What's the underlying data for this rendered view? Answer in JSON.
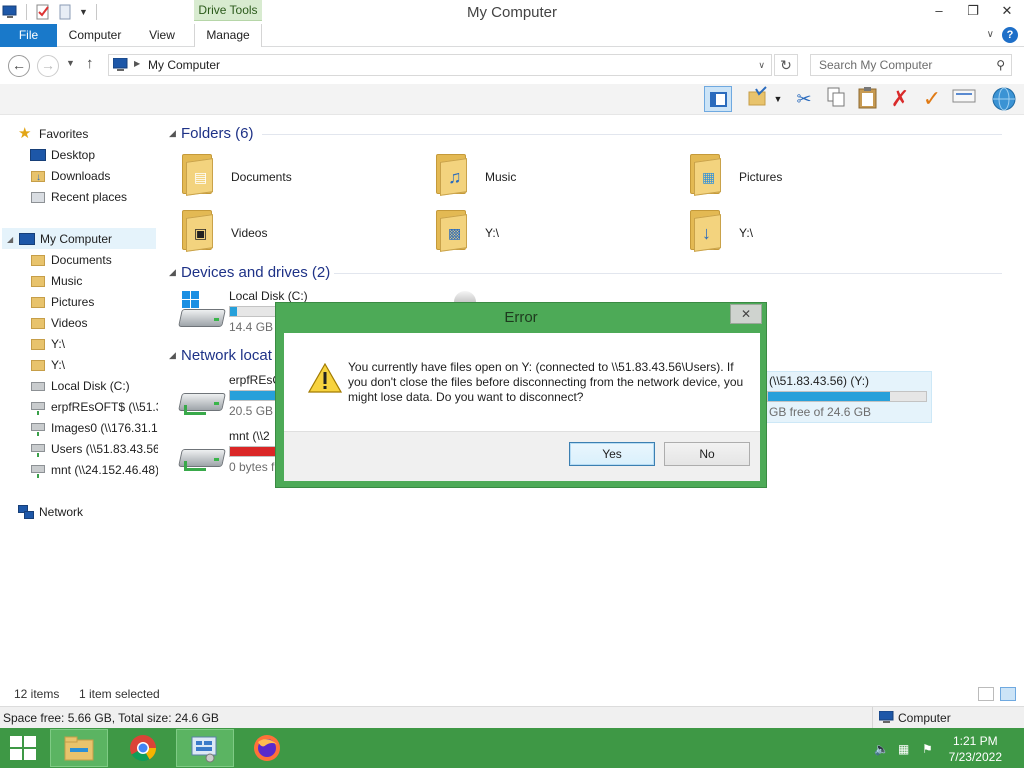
{
  "window": {
    "title": "My Computer",
    "contextual_tab": "Drive Tools",
    "minimize": "–",
    "maximize": "❐",
    "close": "✕"
  },
  "ribbon": {
    "tabs": [
      "File",
      "Computer",
      "View",
      "Manage"
    ]
  },
  "address": {
    "path": "My Computer",
    "search_placeholder": "Search My Computer"
  },
  "nav": {
    "favorites": "Favorites",
    "desktop": "Desktop",
    "downloads": "Downloads",
    "recent": "Recent places",
    "computer": "My Computer",
    "items": [
      "Documents",
      "Music",
      "Pictures",
      "Videos",
      "Y:\\",
      "Y:\\",
      "Local Disk (C:)",
      "erpfREsOFT$ (\\\\51.3",
      "Images0 (\\\\176.31.17",
      "Users (\\\\51.83.43.56)",
      "mnt (\\\\24.152.46.48)"
    ],
    "network": "Network"
  },
  "content": {
    "folders_header": "Folders (6)",
    "folders": [
      "Documents",
      "Music",
      "Pictures",
      "Videos",
      "Y:\\",
      "Y:\\"
    ],
    "devices_header": "Devices and drives (2)",
    "local_disk": {
      "name": "Local Disk (C:)",
      "free": "14.4 GB f",
      "used_fraction": 0.04
    },
    "network_header": "Network locat",
    "net_drives": [
      {
        "name": "erpfREsC",
        "free": "20.5 GB f",
        "used_fraction": 1.0
      },
      {
        "name": "mnt (\\\\2",
        "free": "0 bytes f",
        "used_fraction": 1.0,
        "critical": true
      }
    ],
    "users_drive": {
      "name": "(\\\\51.83.43.56) (Y:)",
      "free": "GB free of 24.6 GB",
      "used_fraction": 0.77
    }
  },
  "status": {
    "items": "12 items",
    "selected": "1 item selected",
    "space": "Space free: 5.66 GB, Total size: 24.6 GB",
    "zone": "Computer"
  },
  "dialog": {
    "title": "Error",
    "close": "✕",
    "message": "You currently have files open on Y: (connected to \\\\51.83.43.56\\Users). If you don't close the files before disconnecting from the network device, you might lose data. Do you want to disconnect?",
    "yes": "Yes",
    "no": "No"
  },
  "taskbar": {
    "time": "1:21 PM",
    "date": "7/23/2022"
  },
  "colors": {
    "accent": "#1979ca",
    "taskbar": "#3e9845",
    "dialog_frame": "#4daa57"
  }
}
